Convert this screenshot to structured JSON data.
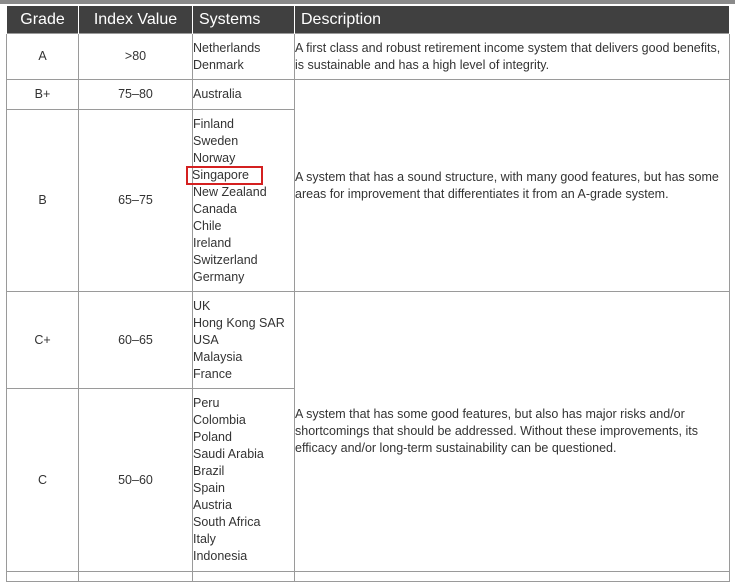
{
  "table": {
    "headers": {
      "grade": "Grade",
      "index": "Index Value",
      "systems": "Systems",
      "description": "Description"
    },
    "rows": [
      {
        "grade": "A",
        "index": ">80",
        "systems": [
          "Netherlands",
          "Denmark"
        ],
        "description": "A first class and robust retirement income system that delivers good benefits, is sustainable and has a high level of integrity."
      },
      {
        "grade": "B+",
        "index": "75–80",
        "systems": [
          "Australia"
        ]
      },
      {
        "grade": "B",
        "index": "65–75",
        "systems": [
          "Finland",
          "Sweden",
          "Norway",
          "Singapore",
          "New Zealand",
          "Canada",
          "Chile",
          "Ireland",
          "Switzerland",
          "Germany"
        ],
        "highlighted_system": "Singapore"
      },
      {
        "grade": "C+",
        "index": "60–65",
        "systems": [
          "UK",
          "Hong Kong SAR",
          "USA",
          "Malaysia",
          "France"
        ]
      },
      {
        "grade": "C",
        "index": "50–60",
        "systems": [
          "Peru",
          "Colombia",
          "Poland",
          "Saudi Arabia",
          "Brazil",
          "Spain",
          "Austria",
          "South Africa",
          "Italy",
          "Indonesia"
        ]
      }
    ],
    "group_descriptions": {
      "b_grades": "A system that has a sound structure, with many good features, but has some areas for improvement that differentiates it from an A-grade system.",
      "c_grades": "A system that has some good features, but also has major risks and/or shortcomings that should be addressed. Without these improvements, its efficacy and/or long-term sustainability can be questioned."
    }
  },
  "colors": {
    "header_bg": "#404040",
    "header_text": "#ffffff",
    "border": "#9a9a9a",
    "highlight": "#d42020"
  }
}
